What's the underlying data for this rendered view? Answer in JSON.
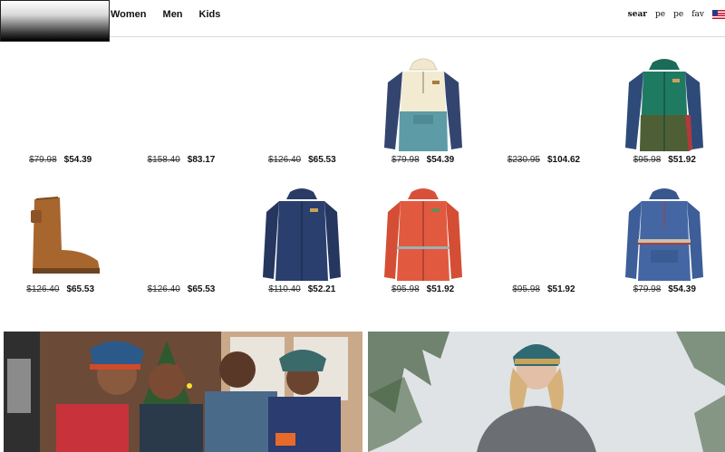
{
  "header": {
    "nav": [
      "Women",
      "Men",
      "Kids"
    ],
    "utility": {
      "search": "sear",
      "icon2": "pe",
      "icon3": "pe",
      "icon4": "fav"
    },
    "flag_colors": {
      "red": "#c8102e",
      "blue": "#1f3a93"
    }
  },
  "products": [
    {
      "old": "$79.98",
      "price": "$54.39",
      "image": "none"
    },
    {
      "old": "$158.40",
      "price": "$83.17",
      "image": "none"
    },
    {
      "old": "$126.40",
      "price": "$65.53",
      "image": "none"
    },
    {
      "old": "$79.98",
      "price": "$54.39",
      "image": "anorak-cream-teal"
    },
    {
      "old": "$230.95",
      "price": "$104.62",
      "image": "none"
    },
    {
      "old": "$95.98",
      "price": "$51.92",
      "image": "jacket-green-navy"
    },
    {
      "old": "$126.40",
      "price": "$65.53",
      "image": "boot-brown"
    },
    {
      "old": "$126.40",
      "price": "$65.53",
      "image": "none"
    },
    {
      "old": "$110.40",
      "price": "$52.21",
      "image": "jacket-navy"
    },
    {
      "old": "$95.98",
      "price": "$51.92",
      "image": "jacket-red"
    },
    {
      "old": "$95.98",
      "price": "$51.92",
      "image": "none"
    },
    {
      "old": "$79.98",
      "price": "$54.39",
      "image": "anorak-blue"
    }
  ],
  "banners": [
    {
      "scene": "family-holiday-photo"
    },
    {
      "scene": "woman-outdoor-winter-photo"
    }
  ]
}
